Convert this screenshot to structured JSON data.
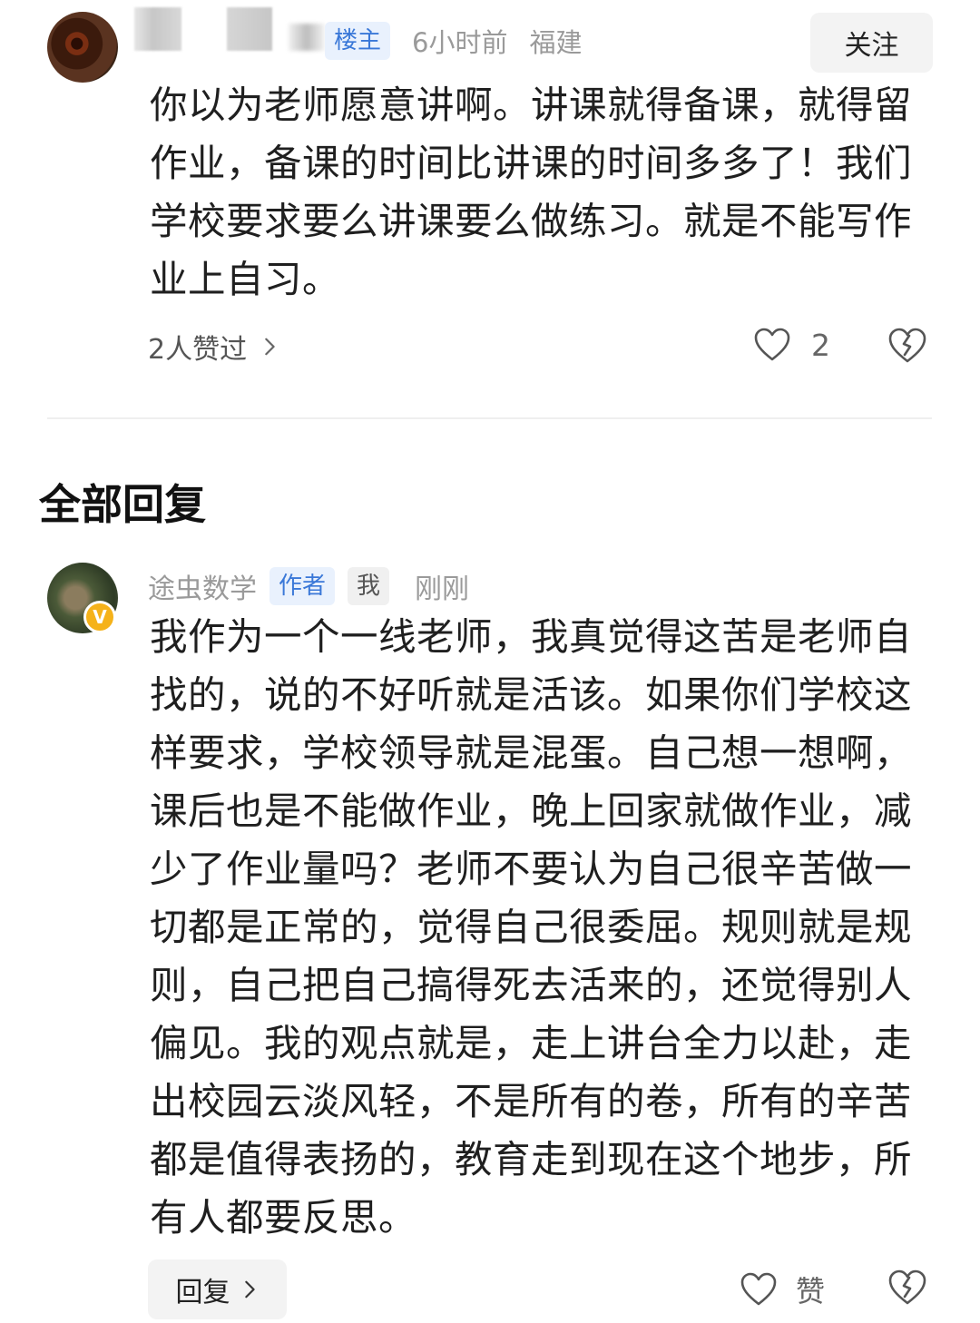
{
  "top_comment": {
    "author_badge": "楼主",
    "time": "6小时前",
    "location": "福建",
    "follow_label": "关注",
    "text": "你以为老师愿意讲啊。讲课就得备课，就得留作业，备课的时间比讲课的时间多多了！我们学校要求要么讲课要么做练习。就是不能写作业上自习。",
    "likers_label": "2人赞过",
    "like_count": "2"
  },
  "section": {
    "title": "全部回复"
  },
  "reply": {
    "author": "途虫数学",
    "author_badge": "作者",
    "me_badge": "我",
    "time": "刚刚",
    "verified_mark": "V",
    "text": "我作为一个一线老师，我真觉得这苦是老师自找的，说的不好听就是活该。如果你们学校这样要求，学校领导就是混蛋。自己想一想啊，课后也是不能做作业，晚上回家就做作业，减少了作业量吗？老师不要认为自己很辛苦做一切都是正常的，觉得自己很委屈。规则就是规则，自己把自己搞得死去活来的，还觉得别人偏见。我的观点就是，走上讲台全力以赴，走出校园云淡风轻，不是所有的卷，所有的辛苦都是值得表扬的，教育走到现在这个地步，所有人都要反思。",
    "reply_label": "回复",
    "like_label": "赞"
  },
  "colors": {
    "badge_blue_bg": "#e9f1fd",
    "badge_blue_text": "#3a78d8",
    "verified": "#f5b21a"
  },
  "icons": [
    "heart-outline-icon",
    "broken-heart-icon",
    "chevron-right-icon",
    "verified-badge-icon"
  ]
}
